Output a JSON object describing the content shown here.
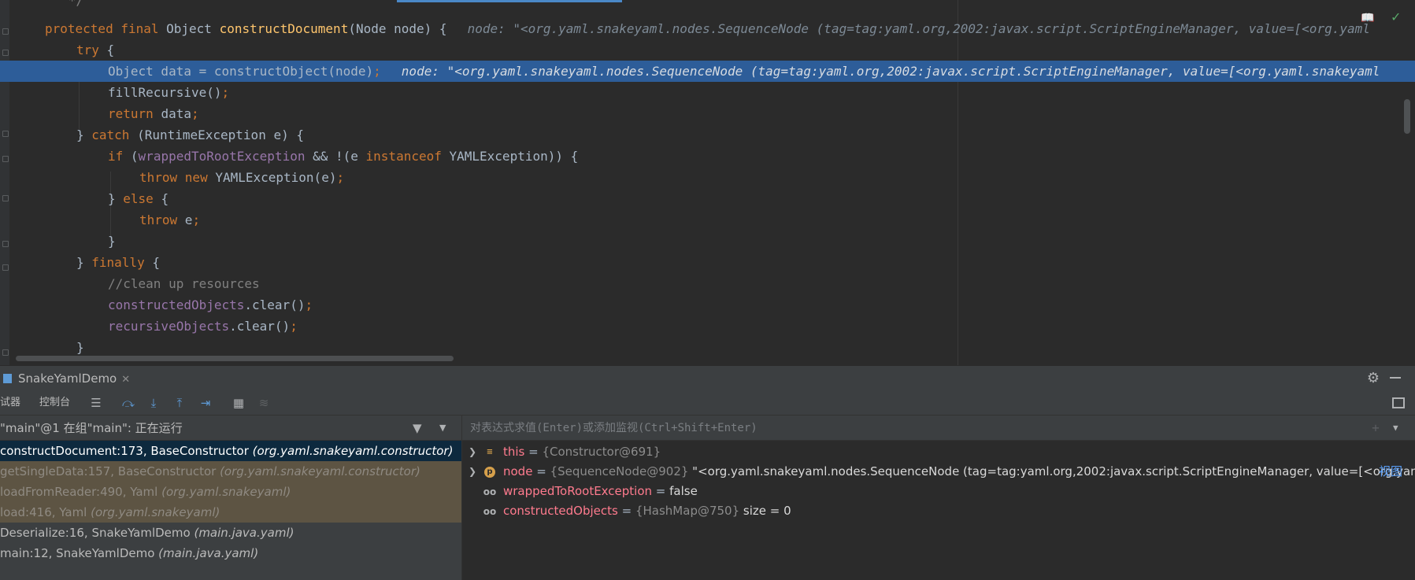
{
  "editor": {
    "lines": [
      {
        "text": "   */",
        "type": "comment"
      },
      {
        "text": "protected final Object constructDocument(Node node) {",
        "hint": "node: \"<org.yaml.snakeyaml.nodes.SequenceNode (tag=tag:yaml.org,2002:javax.script.ScriptEngineManager, value=[<org.yaml"
      },
      {
        "text": "try {"
      },
      {
        "text": "Object data = constructObject(node);",
        "hint": "node: \"<org.yaml.snakeyaml.nodes.SequenceNode (tag=tag:yaml.org,2002:javax.script.ScriptEngineManager, value=[<org.yaml.snakeyaml"
      },
      {
        "text": "fillRecursive();"
      },
      {
        "text": "return data;"
      },
      {
        "text": "} catch (RuntimeException e) {"
      },
      {
        "text": "if (wrappedToRootException && !(e instanceof YAMLException)) {"
      },
      {
        "text": "throw new YAMLException(e);"
      },
      {
        "text": "} else {"
      },
      {
        "text": "throw e;"
      },
      {
        "text": "}"
      },
      {
        "text": "} finally {"
      },
      {
        "text": "//clean up resources"
      },
      {
        "text": "constructedObjects.clear();"
      },
      {
        "text": "recursiveObjects.clear();"
      },
      {
        "text": "}"
      }
    ]
  },
  "panel": {
    "session_tab": "SnakeYamlDemo",
    "tabs": [
      "试器",
      "控制台"
    ],
    "thread_status": "\"main\"@1 在组\"main\": 正在运行",
    "frames": [
      {
        "method": "constructDocument:173, BaseConstructor ",
        "pkg": "(org.yaml.snakeyaml.constructor)"
      },
      {
        "method": "getSingleData:157, BaseConstructor ",
        "pkg": "(org.yaml.snakeyaml.constructor)"
      },
      {
        "method": "loadFromReader:490, Yaml ",
        "pkg": "(org.yaml.snakeyaml)"
      },
      {
        "method": "load:416, Yaml ",
        "pkg": "(org.yaml.snakeyaml)"
      },
      {
        "method": "Deserialize:16, SnakeYamlDemo ",
        "pkg": "(main.java.yaml)"
      },
      {
        "method": "main:12, SnakeYamlDemo ",
        "pkg": "(main.java.yaml)"
      }
    ],
    "eval_placeholder": "对表达式求值(Enter)或添加监视(Ctrl+Shift+Enter)",
    "variables": [
      {
        "name": "this",
        "eq": " = ",
        "type": "{Constructor@691}",
        "extra": ""
      },
      {
        "name": "node",
        "eq": " = ",
        "type": "{SequenceNode@902}",
        "extra": " \"<org.yaml.snakeyaml.nodes.SequenceNode (tag=tag:yaml.org,2002:javax.script.ScriptEngineManager, value=[<org.yam..."
      },
      {
        "name": "wrappedToRootException",
        "eq": " = ",
        "type": "",
        "extra": "false"
      },
      {
        "name": "constructedObjects",
        "eq": " = ",
        "type": "{HashMap@750}",
        "extra": "  size = 0"
      }
    ],
    "view_link": "视图"
  }
}
